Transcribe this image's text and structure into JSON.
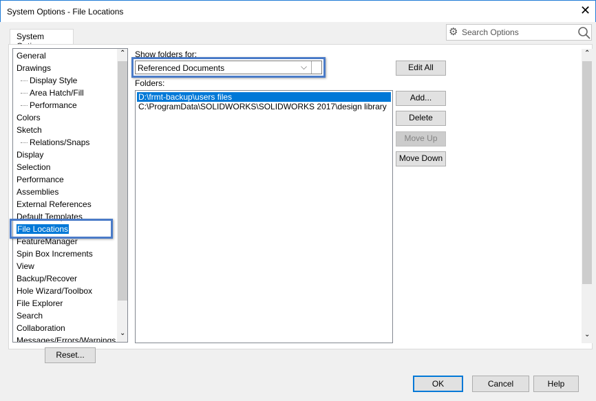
{
  "window": {
    "title": "System Options - File Locations",
    "close_icon": "close-icon"
  },
  "tab": {
    "label": "System Options"
  },
  "search": {
    "placeholder": "Search Options",
    "gear_icon": "gear-icon",
    "search_icon": "magnifier-icon"
  },
  "tree": {
    "items": [
      {
        "label": "General",
        "sub": false
      },
      {
        "label": "Drawings",
        "sub": false
      },
      {
        "label": "Display Style",
        "sub": true
      },
      {
        "label": "Area Hatch/Fill",
        "sub": true
      },
      {
        "label": "Performance",
        "sub": true
      },
      {
        "label": "Colors",
        "sub": false
      },
      {
        "label": "Sketch",
        "sub": false
      },
      {
        "label": "Relations/Snaps",
        "sub": true
      },
      {
        "label": "Display",
        "sub": false
      },
      {
        "label": "Selection",
        "sub": false
      },
      {
        "label": "Performance",
        "sub": false
      },
      {
        "label": "Assemblies",
        "sub": false
      },
      {
        "label": "External References",
        "sub": false
      },
      {
        "label": "Default Templates",
        "sub": false
      },
      {
        "label": "File Locations",
        "sub": false,
        "selected": true
      },
      {
        "label": "FeatureManager",
        "sub": false
      },
      {
        "label": "Spin Box Increments",
        "sub": false
      },
      {
        "label": "View",
        "sub": false
      },
      {
        "label": "Backup/Recover",
        "sub": false
      },
      {
        "label": "Hole Wizard/Toolbox",
        "sub": false
      },
      {
        "label": "File Explorer",
        "sub": false
      },
      {
        "label": "Search",
        "sub": false
      },
      {
        "label": "Collaboration",
        "sub": false
      },
      {
        "label": "Messages/Errors/Warnings",
        "sub": false
      }
    ]
  },
  "reset_label": "Reset...",
  "show_folders": {
    "label": "Show folders for:",
    "value": "Referenced Documents"
  },
  "folders": {
    "label": "Folders:",
    "items": [
      "D:\\frmt-backup\\users files",
      "C:\\ProgramData\\SOLIDWORKS\\SOLIDWORKS 2017\\design library"
    ],
    "selected_index": 0
  },
  "buttons": {
    "edit_all": "Edit All",
    "add": "Add...",
    "delete": "Delete",
    "move_up": "Move Up",
    "move_down": "Move Down"
  },
  "footer": {
    "ok": "OK",
    "cancel": "Cancel",
    "help": "Help"
  },
  "colors": {
    "selection": "#0078d7",
    "highlight_box": "#4a7bc8"
  }
}
